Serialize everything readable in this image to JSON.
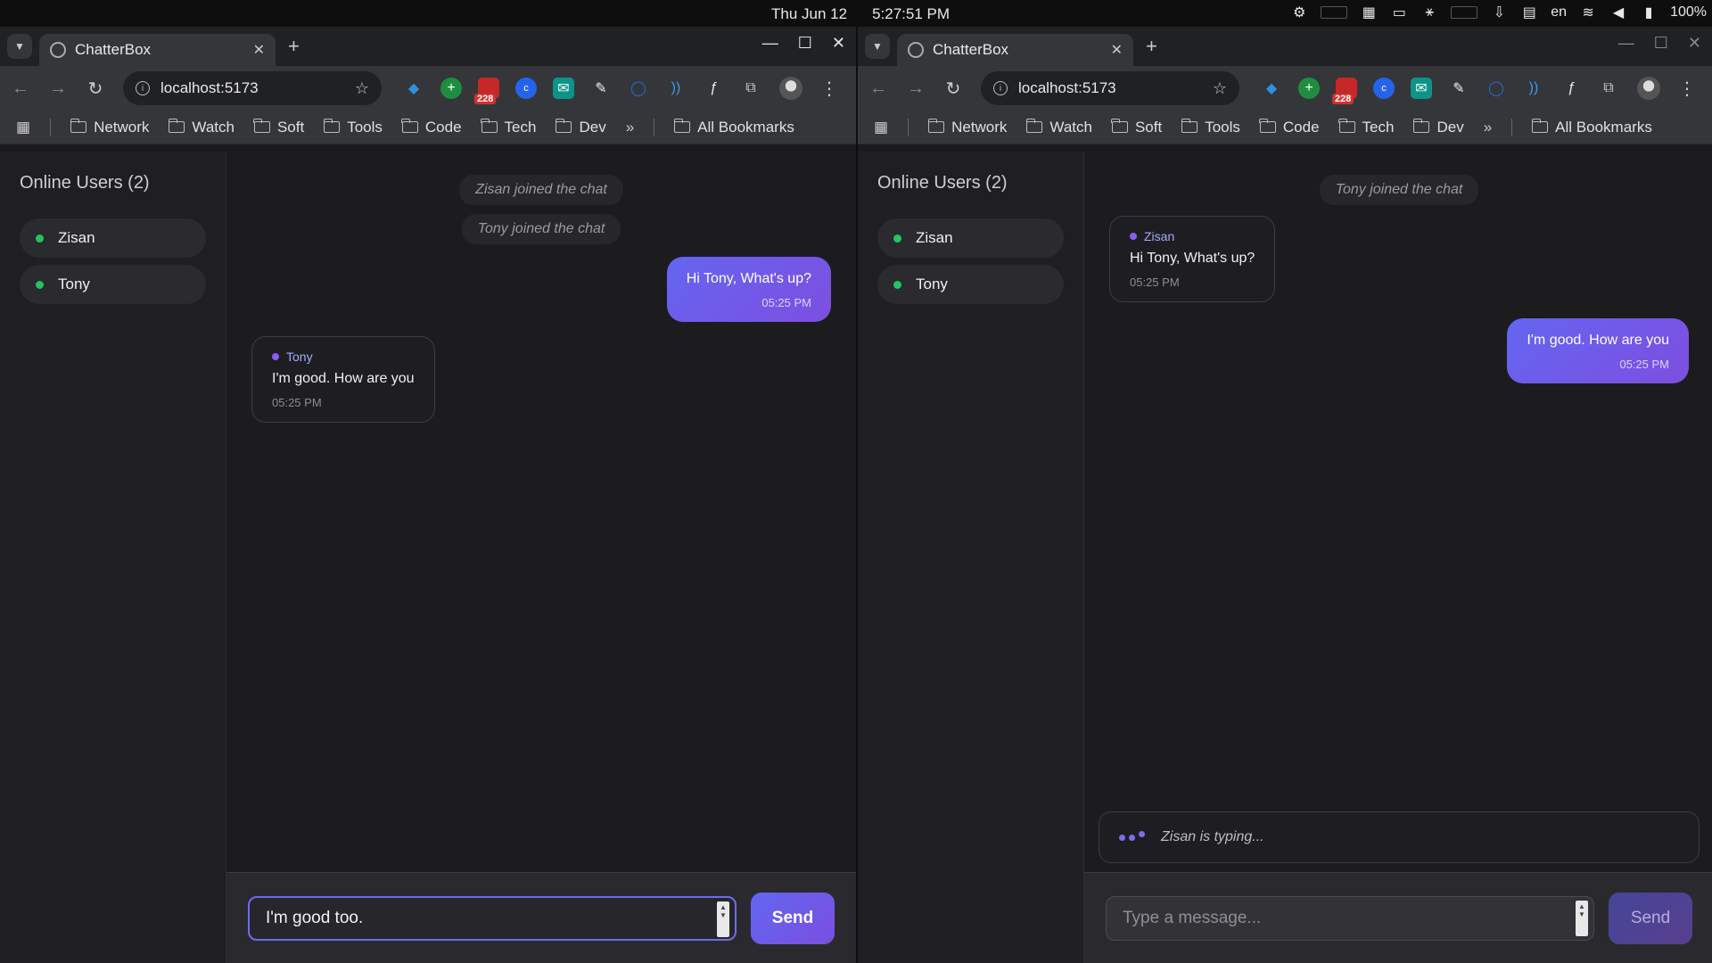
{
  "system": {
    "date": "Thu Jun 12",
    "time": "5:27:51 PM",
    "lang": "en",
    "battery": "100%"
  },
  "browser": {
    "tab_title": "ChatterBox",
    "url": "localhost:5173",
    "ext_badge": "228",
    "bookmarks": [
      "Network",
      "Watch",
      "Soft",
      "Tools",
      "Code",
      "Tech",
      "Dev"
    ],
    "all_bookmarks": "All Bookmarks"
  },
  "app": {
    "sidebar_title": "Online Users (2)",
    "users": [
      "Zisan",
      "Tony"
    ],
    "send_label": "Send",
    "placeholder": "Type a message..."
  },
  "left": {
    "system_msgs": [
      "Zisan joined the chat",
      "Tony joined the chat"
    ],
    "msg1": {
      "text": "Hi Tony, What's up?",
      "time": "05:25 PM"
    },
    "msg2": {
      "sender": "Tony",
      "text": "I'm good. How are you",
      "time": "05:25 PM"
    },
    "input_value": "I'm good too."
  },
  "right": {
    "system_msgs": [
      "Tony joined the chat"
    ],
    "msg1": {
      "sender": "Zisan",
      "text": "Hi Tony, What's up?",
      "time": "05:25 PM"
    },
    "msg2": {
      "text": "I'm good. How are you",
      "time": "05:25 PM"
    },
    "typing_text": "Zisan is typing..."
  }
}
